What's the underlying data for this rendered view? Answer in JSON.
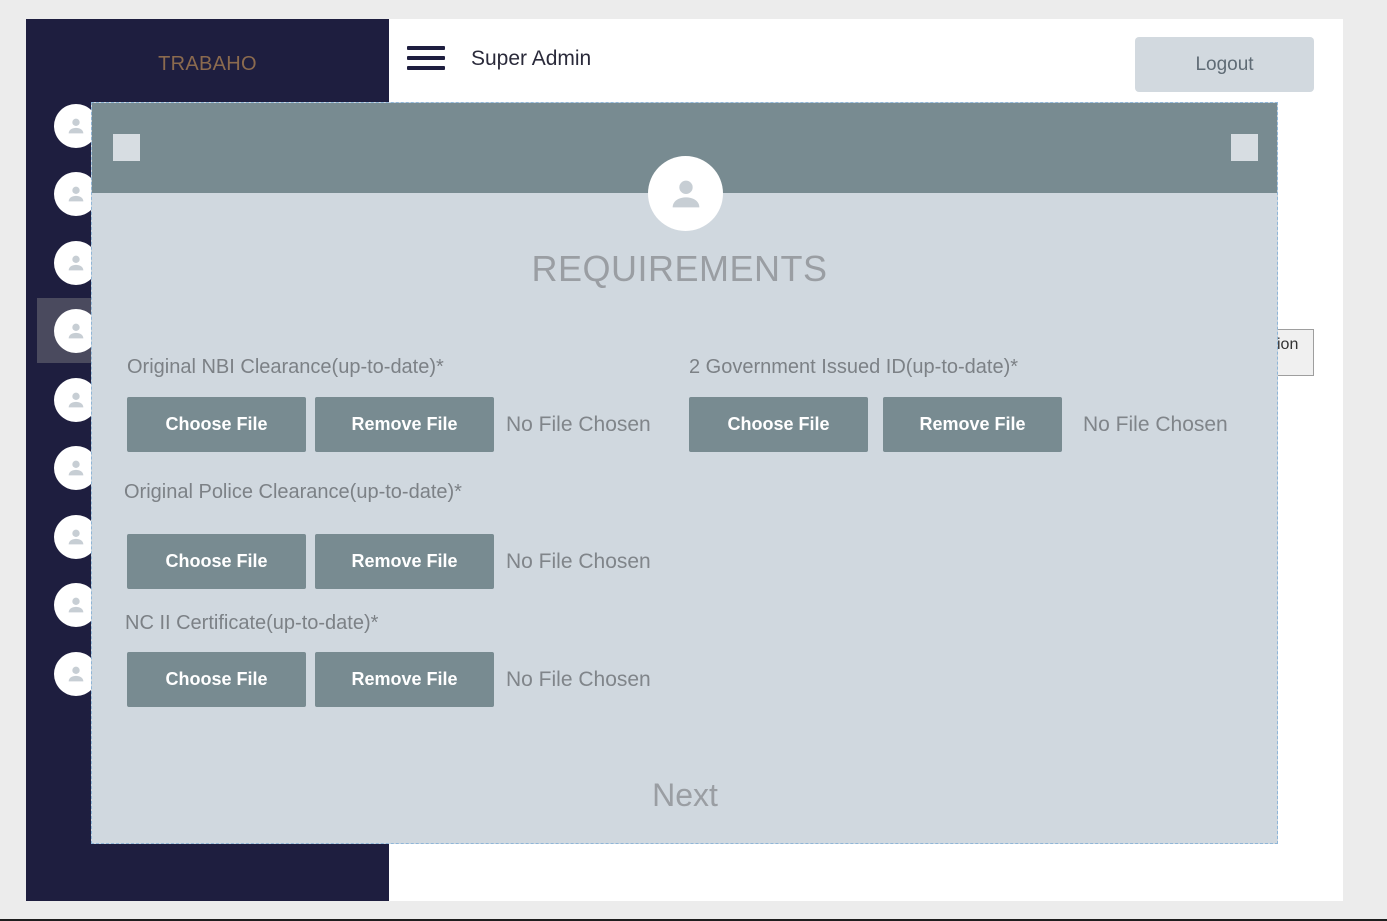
{
  "sidebar": {
    "brand": "TRABAHO",
    "items": [
      "user-icon",
      "user-icon",
      "user-icon",
      "user-icon",
      "user-icon",
      "user-icon",
      "user-icon",
      "user-icon",
      "user-icon"
    ],
    "active_index": 3
  },
  "topbar": {
    "title": "Super Admin",
    "logout_label": "Logout"
  },
  "background": {
    "partial_button_text": "ion"
  },
  "modal": {
    "title": "REQUIREMENTS",
    "requirements": [
      {
        "label": "Original NBI Clearance(up-to-date)*",
        "choose_label": "Choose File",
        "remove_label": "Remove File",
        "status": "No File Chosen"
      },
      {
        "label": "2 Government Issued ID(up-to-date)*",
        "choose_label": "Choose File",
        "remove_label": "Remove File",
        "status": "No File Chosen"
      },
      {
        "label": "Original Police Clearance(up-to-date)*",
        "choose_label": "Choose File",
        "remove_label": "Remove File",
        "status": "No File Chosen"
      },
      {
        "label": "NC II Certificate(up-to-date)*",
        "choose_label": "Choose File",
        "remove_label": "Remove File",
        "status": "No File Chosen"
      }
    ],
    "next_label": "Next"
  },
  "colors": {
    "sidebar_bg": "#1e1e3f",
    "brand": "#8b6a4e",
    "modal_bg": "#d0d8df",
    "modal_header": "#788b91",
    "button_bg": "#788b91"
  }
}
